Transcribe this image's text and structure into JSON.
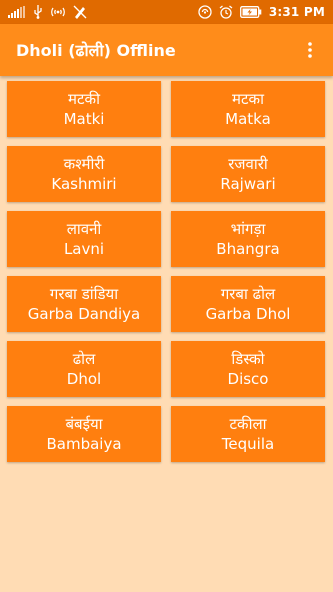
{
  "status_bar": {
    "time": "3:31 PM",
    "icons": [
      "signal-icon",
      "usb-icon",
      "hotspot-icon",
      "no-sim-icon",
      "nfc-icon",
      "alarm-icon",
      "battery-charging-icon"
    ]
  },
  "app_bar": {
    "title": "Dholi (ढोली) Offline",
    "menu_icon": "more-vert-icon"
  },
  "tiles": [
    {
      "hindi": "मटकी",
      "latin": "Matki"
    },
    {
      "hindi": "मटका",
      "latin": "Matka"
    },
    {
      "hindi": "कश्मीरी",
      "latin": "Kashmiri"
    },
    {
      "hindi": "रजवारी",
      "latin": "Rajwari"
    },
    {
      "hindi": "लावनी",
      "latin": "Lavni"
    },
    {
      "hindi": "भांगड़ा",
      "latin": "Bhangra"
    },
    {
      "hindi": "गरबा डांडिया",
      "latin": "Garba Dandiya"
    },
    {
      "hindi": "गरबा ढोल",
      "latin": "Garba Dhol"
    },
    {
      "hindi": "ढोल",
      "latin": "Dhol"
    },
    {
      "hindi": "डिस्को",
      "latin": "Disco"
    },
    {
      "hindi": "बंबईया",
      "latin": "Bambaiya"
    },
    {
      "hindi": "टकीला",
      "latin": "Tequila"
    }
  ],
  "colors": {
    "background": "#ffdcb4",
    "status_bar": "#e06a00",
    "app_bar": "#ff8c1a",
    "tile": "#ff7f0f",
    "text": "#ffffff"
  }
}
